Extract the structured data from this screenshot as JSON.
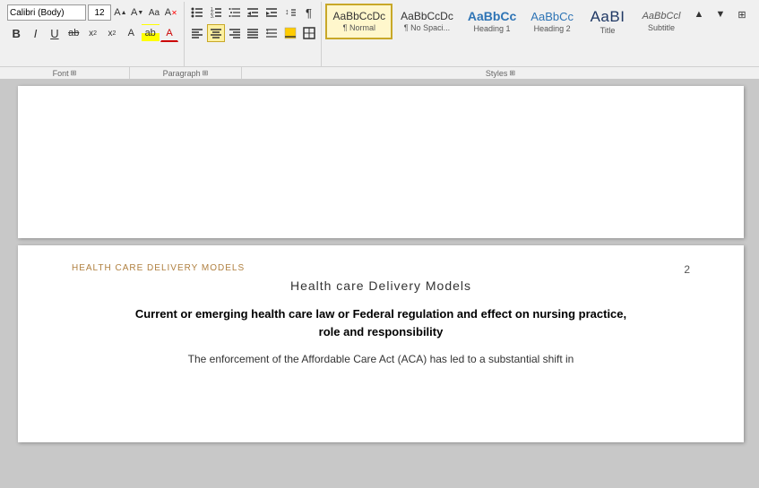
{
  "ribbon": {
    "font": {
      "name": "Calibri (Body)",
      "size": "12",
      "grow_label": "A",
      "shrink_label": "A",
      "change_case_label": "Aa",
      "clear_label": "A"
    },
    "font_format": {
      "bold": "B",
      "italic": "I",
      "underline": "U",
      "strikethrough": "ab",
      "subscript": "x₂",
      "superscript": "x²",
      "highlight": "ab",
      "color": "A"
    },
    "paragraph": {
      "bullets_label": "≡",
      "numbering_label": "≡",
      "multilevel_label": "≡",
      "dec_indent_label": "⇤",
      "inc_indent_label": "⇥",
      "sort_label": "↕",
      "show_marks_label": "¶",
      "align_left": "≡",
      "align_center": "≡",
      "align_right": "≡",
      "justify": "≡",
      "line_spacing": "↕",
      "shading": "▓",
      "borders": "⊞"
    },
    "styles": [
      {
        "id": "normal",
        "preview": "AaBbCcDc",
        "label": "¶ Normal",
        "selected": true,
        "class": "normal-s"
      },
      {
        "id": "no-spacing",
        "preview": "AaBbCcDc",
        "label": "¶ No Spaci...",
        "selected": false,
        "class": "nospace-s"
      },
      {
        "id": "heading1",
        "preview": "AaBbCc",
        "label": "Heading 1",
        "selected": false,
        "class": "h1-s"
      },
      {
        "id": "heading2",
        "preview": "AaBbCc",
        "label": "Heading 2",
        "selected": false,
        "class": "h2-s"
      },
      {
        "id": "title",
        "preview": "AaBI",
        "label": "Title",
        "selected": false,
        "class": "title-s"
      },
      {
        "id": "subtitle",
        "preview": "AaBbCcl",
        "label": "Subtitle",
        "selected": false,
        "class": "subtitle-s"
      }
    ],
    "group_labels": {
      "font": "Font",
      "paragraph": "Paragraph",
      "styles": "Styles"
    }
  },
  "document": {
    "page1": {
      "content": ""
    },
    "page2": {
      "header": "HEALTH CARE DELIVERY MODELS",
      "page_num": "2",
      "title": "Health care Delivery Models",
      "bold_heading_line1": "Current or emerging health care law or Federal regulation and effect on nursing practice,",
      "bold_heading_line2": "role and responsibility",
      "body_text": "The enforcement of the Affordable Care Act (ACA) has led to a substantial shift in"
    }
  }
}
